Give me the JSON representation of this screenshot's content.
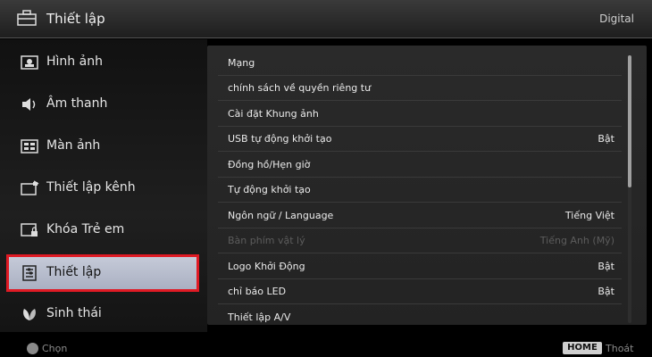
{
  "header": {
    "title": "Thiết lập",
    "source": "Digital"
  },
  "sidebar": {
    "items": [
      {
        "label": "Hình ảnh",
        "icon": "picture-icon"
      },
      {
        "label": "Âm thanh",
        "icon": "speaker-icon"
      },
      {
        "label": "Màn ảnh",
        "icon": "screen-icon"
      },
      {
        "label": "Thiết lập kênh",
        "icon": "channel-setup-icon"
      },
      {
        "label": "Khóa Trẻ em",
        "icon": "parental-lock-icon"
      },
      {
        "label": "Thiết lập",
        "icon": "settings-icon",
        "selected": true
      },
      {
        "label": "Sinh thái",
        "icon": "eco-icon"
      }
    ]
  },
  "settings_list": [
    {
      "label": "Mạng",
      "value": ""
    },
    {
      "label": "chính sách về quyền riêng tư",
      "value": ""
    },
    {
      "label": "Cài đặt Khung ảnh",
      "value": ""
    },
    {
      "label": "USB tự động khởi tạo",
      "value": "Bật"
    },
    {
      "label": "Đồng hồ/Hẹn giờ",
      "value": ""
    },
    {
      "label": "Tự động khởi tạo",
      "value": ""
    },
    {
      "label": "Ngôn ngữ / Language",
      "value": "Tiếng Việt"
    },
    {
      "label": "Bàn phím vật lý",
      "value": "Tiếng Anh (Mỹ)",
      "disabled": true
    },
    {
      "label": "Logo Khởi Động",
      "value": "Bật"
    },
    {
      "label": "chỉ báo LED",
      "value": "Bật"
    },
    {
      "label": "Thiết lập A/V",
      "value": ""
    }
  ],
  "footer": {
    "select_label": "Chọn",
    "home_badge": "HOME",
    "exit_label": "Thoát"
  },
  "colors": {
    "selection_outline": "#e01a24",
    "selection_fill": "#b8bdcc",
    "background": "#000000"
  }
}
